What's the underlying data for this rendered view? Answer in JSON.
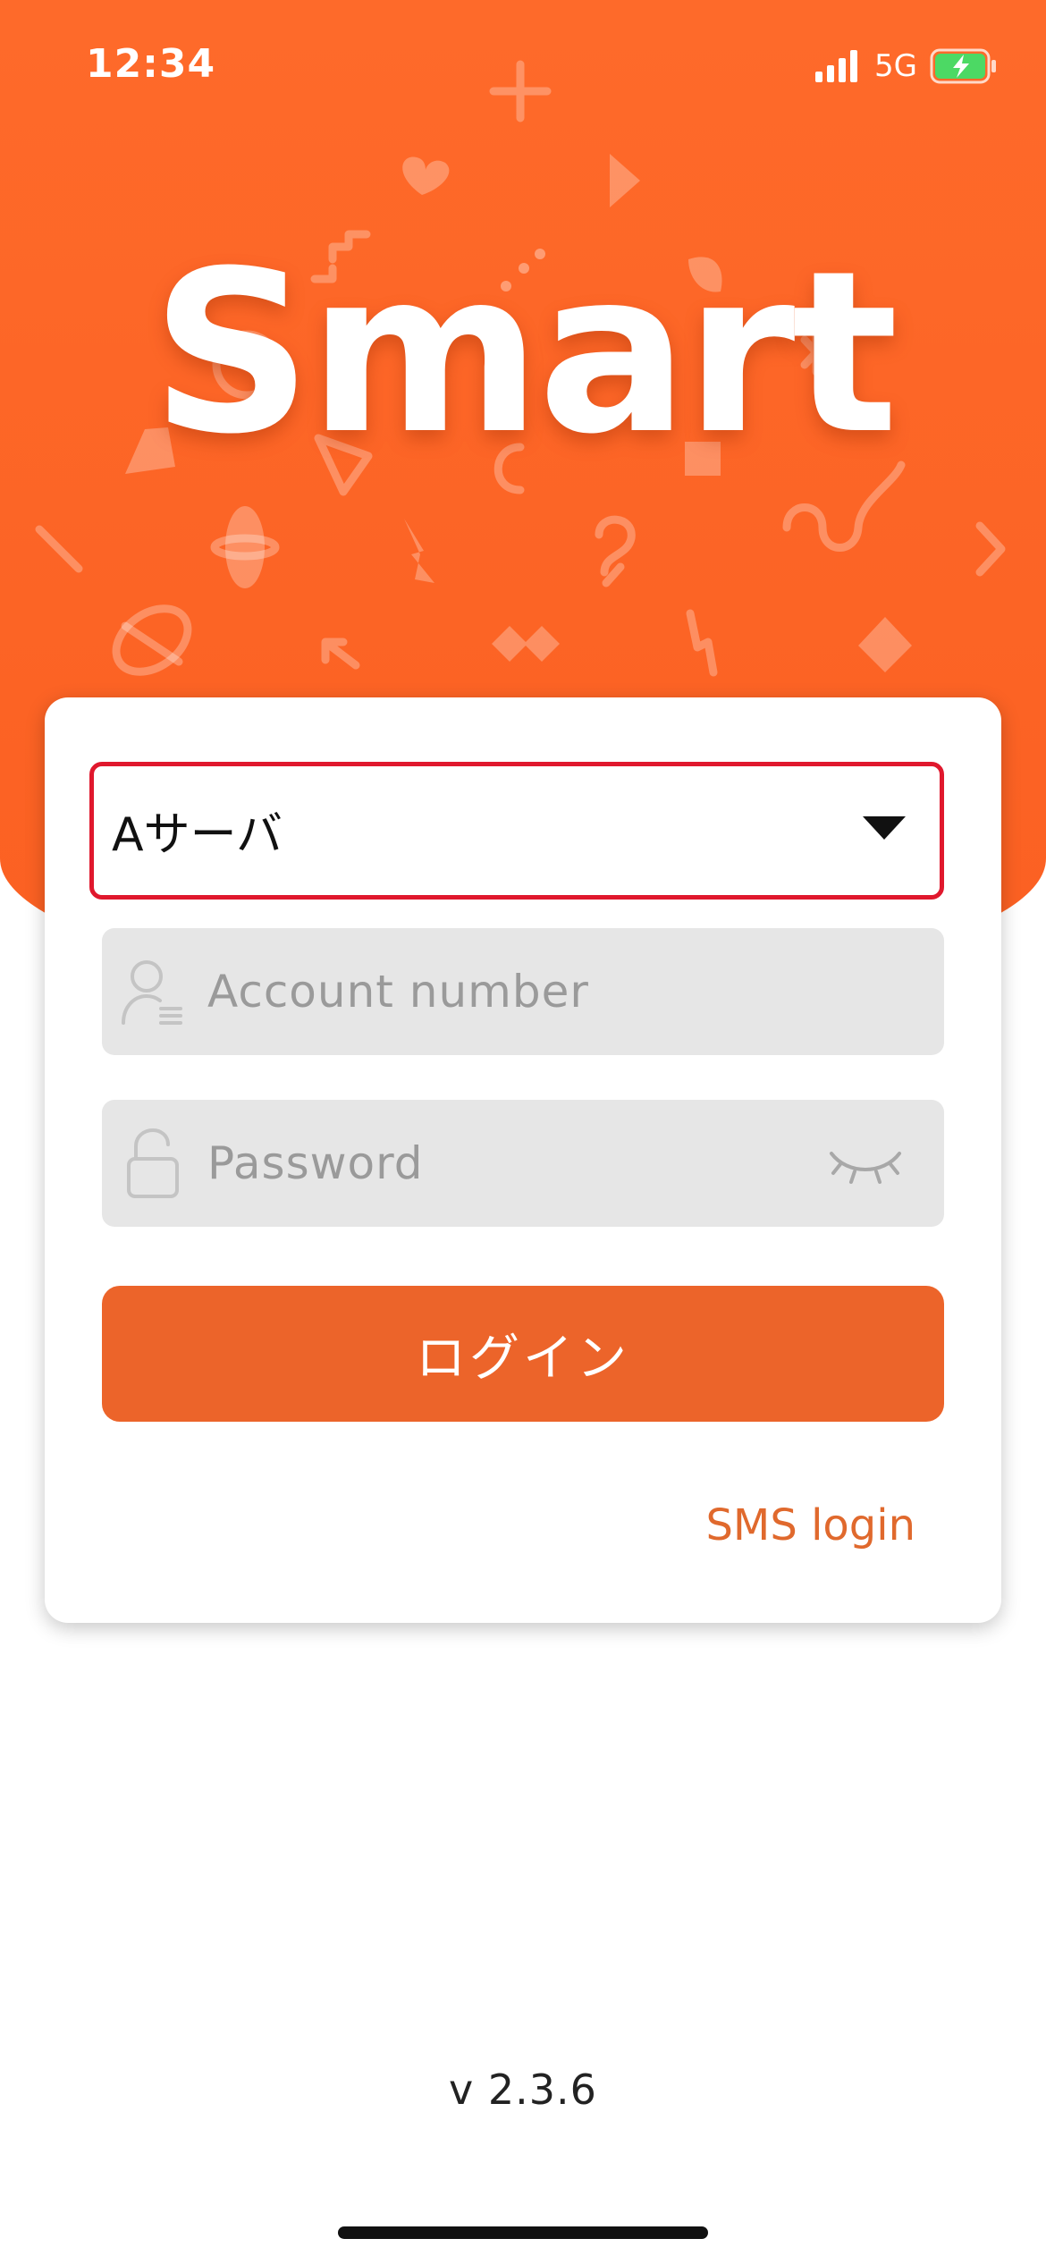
{
  "status_bar": {
    "time": "12:34",
    "network": "5G",
    "signal_icon": "cellular-signal-icon",
    "battery_icon": "battery-charging-icon"
  },
  "brand": {
    "title": "Smart"
  },
  "login_form": {
    "server_select": {
      "value": "Aサーバ",
      "icon": "dropdown-caret-icon"
    },
    "account_field": {
      "placeholder": "Account number",
      "icon": "user-icon"
    },
    "password_field": {
      "placeholder": "Password",
      "icon": "lock-icon",
      "toggle_icon": "eye-closed-icon"
    },
    "login_button_label": "ログイン",
    "sms_login_link": "SMS login"
  },
  "footer": {
    "version": "v 2.3.6"
  },
  "colors": {
    "brand_orange": "#fe6a2a",
    "button_orange": "#ec642a",
    "link_orange": "#e0692d",
    "highlight_red": "#e0182d",
    "field_gray": "#e6e6e6"
  }
}
